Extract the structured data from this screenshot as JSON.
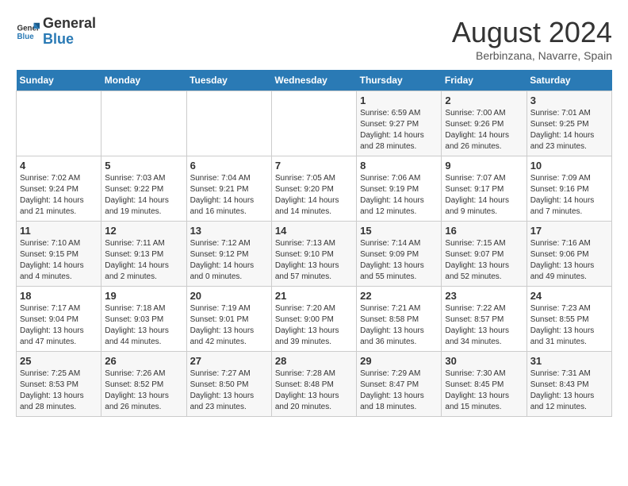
{
  "logo": {
    "text_general": "General",
    "text_blue": "Blue"
  },
  "title": "August 2024",
  "location": "Berbinzana, Navarre, Spain",
  "days_of_week": [
    "Sunday",
    "Monday",
    "Tuesday",
    "Wednesday",
    "Thursday",
    "Friday",
    "Saturday"
  ],
  "weeks": [
    [
      {
        "day": "",
        "info": ""
      },
      {
        "day": "",
        "info": ""
      },
      {
        "day": "",
        "info": ""
      },
      {
        "day": "",
        "info": ""
      },
      {
        "day": "1",
        "info": "Sunrise: 6:59 AM\nSunset: 9:27 PM\nDaylight: 14 hours\nand 28 minutes."
      },
      {
        "day": "2",
        "info": "Sunrise: 7:00 AM\nSunset: 9:26 PM\nDaylight: 14 hours\nand 26 minutes."
      },
      {
        "day": "3",
        "info": "Sunrise: 7:01 AM\nSunset: 9:25 PM\nDaylight: 14 hours\nand 23 minutes."
      }
    ],
    [
      {
        "day": "4",
        "info": "Sunrise: 7:02 AM\nSunset: 9:24 PM\nDaylight: 14 hours\nand 21 minutes."
      },
      {
        "day": "5",
        "info": "Sunrise: 7:03 AM\nSunset: 9:22 PM\nDaylight: 14 hours\nand 19 minutes."
      },
      {
        "day": "6",
        "info": "Sunrise: 7:04 AM\nSunset: 9:21 PM\nDaylight: 14 hours\nand 16 minutes."
      },
      {
        "day": "7",
        "info": "Sunrise: 7:05 AM\nSunset: 9:20 PM\nDaylight: 14 hours\nand 14 minutes."
      },
      {
        "day": "8",
        "info": "Sunrise: 7:06 AM\nSunset: 9:19 PM\nDaylight: 14 hours\nand 12 minutes."
      },
      {
        "day": "9",
        "info": "Sunrise: 7:07 AM\nSunset: 9:17 PM\nDaylight: 14 hours\nand 9 minutes."
      },
      {
        "day": "10",
        "info": "Sunrise: 7:09 AM\nSunset: 9:16 PM\nDaylight: 14 hours\nand 7 minutes."
      }
    ],
    [
      {
        "day": "11",
        "info": "Sunrise: 7:10 AM\nSunset: 9:15 PM\nDaylight: 14 hours\nand 4 minutes."
      },
      {
        "day": "12",
        "info": "Sunrise: 7:11 AM\nSunset: 9:13 PM\nDaylight: 14 hours\nand 2 minutes."
      },
      {
        "day": "13",
        "info": "Sunrise: 7:12 AM\nSunset: 9:12 PM\nDaylight: 14 hours\nand 0 minutes."
      },
      {
        "day": "14",
        "info": "Sunrise: 7:13 AM\nSunset: 9:10 PM\nDaylight: 13 hours\nand 57 minutes."
      },
      {
        "day": "15",
        "info": "Sunrise: 7:14 AM\nSunset: 9:09 PM\nDaylight: 13 hours\nand 55 minutes."
      },
      {
        "day": "16",
        "info": "Sunrise: 7:15 AM\nSunset: 9:07 PM\nDaylight: 13 hours\nand 52 minutes."
      },
      {
        "day": "17",
        "info": "Sunrise: 7:16 AM\nSunset: 9:06 PM\nDaylight: 13 hours\nand 49 minutes."
      }
    ],
    [
      {
        "day": "18",
        "info": "Sunrise: 7:17 AM\nSunset: 9:04 PM\nDaylight: 13 hours\nand 47 minutes."
      },
      {
        "day": "19",
        "info": "Sunrise: 7:18 AM\nSunset: 9:03 PM\nDaylight: 13 hours\nand 44 minutes."
      },
      {
        "day": "20",
        "info": "Sunrise: 7:19 AM\nSunset: 9:01 PM\nDaylight: 13 hours\nand 42 minutes."
      },
      {
        "day": "21",
        "info": "Sunrise: 7:20 AM\nSunset: 9:00 PM\nDaylight: 13 hours\nand 39 minutes."
      },
      {
        "day": "22",
        "info": "Sunrise: 7:21 AM\nSunset: 8:58 PM\nDaylight: 13 hours\nand 36 minutes."
      },
      {
        "day": "23",
        "info": "Sunrise: 7:22 AM\nSunset: 8:57 PM\nDaylight: 13 hours\nand 34 minutes."
      },
      {
        "day": "24",
        "info": "Sunrise: 7:23 AM\nSunset: 8:55 PM\nDaylight: 13 hours\nand 31 minutes."
      }
    ],
    [
      {
        "day": "25",
        "info": "Sunrise: 7:25 AM\nSunset: 8:53 PM\nDaylight: 13 hours\nand 28 minutes."
      },
      {
        "day": "26",
        "info": "Sunrise: 7:26 AM\nSunset: 8:52 PM\nDaylight: 13 hours\nand 26 minutes."
      },
      {
        "day": "27",
        "info": "Sunrise: 7:27 AM\nSunset: 8:50 PM\nDaylight: 13 hours\nand 23 minutes."
      },
      {
        "day": "28",
        "info": "Sunrise: 7:28 AM\nSunset: 8:48 PM\nDaylight: 13 hours\nand 20 minutes."
      },
      {
        "day": "29",
        "info": "Sunrise: 7:29 AM\nSunset: 8:47 PM\nDaylight: 13 hours\nand 18 minutes."
      },
      {
        "day": "30",
        "info": "Sunrise: 7:30 AM\nSunset: 8:45 PM\nDaylight: 13 hours\nand 15 minutes."
      },
      {
        "day": "31",
        "info": "Sunrise: 7:31 AM\nSunset: 8:43 PM\nDaylight: 13 hours\nand 12 minutes."
      }
    ]
  ]
}
